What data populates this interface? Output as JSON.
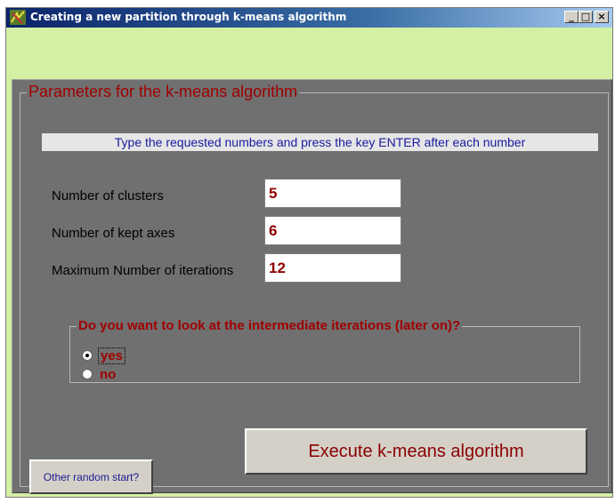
{
  "window": {
    "title": "Creating a new partition through k-means algorithm",
    "minimize_label": "_",
    "maximize_label": "□",
    "close_label": "×"
  },
  "group": {
    "title": "Parameters for the k-means algorithm",
    "instruction": "Type the requested numbers and press the key ENTER after each number"
  },
  "params": {
    "clusters_label": "Number of clusters",
    "clusters_value": "5",
    "axes_label": "Number of kept axes",
    "axes_value": "6",
    "iterations_label": "Maximum Number of iterations",
    "iterations_value": "12"
  },
  "iterations_option": {
    "question": "Do you want to look at the intermediate iterations (later on)?",
    "options": [
      {
        "label": "yes",
        "selected": true
      },
      {
        "label": "no",
        "selected": false
      }
    ]
  },
  "buttons": {
    "execute_label": "Execute k-means algorithm",
    "random_label": "Other random start?"
  },
  "colors": {
    "window_bg": "#d4f0a4",
    "panel_bg": "#707070",
    "accent_red": "#a00000",
    "instruction_text": "#1a1aa0"
  }
}
